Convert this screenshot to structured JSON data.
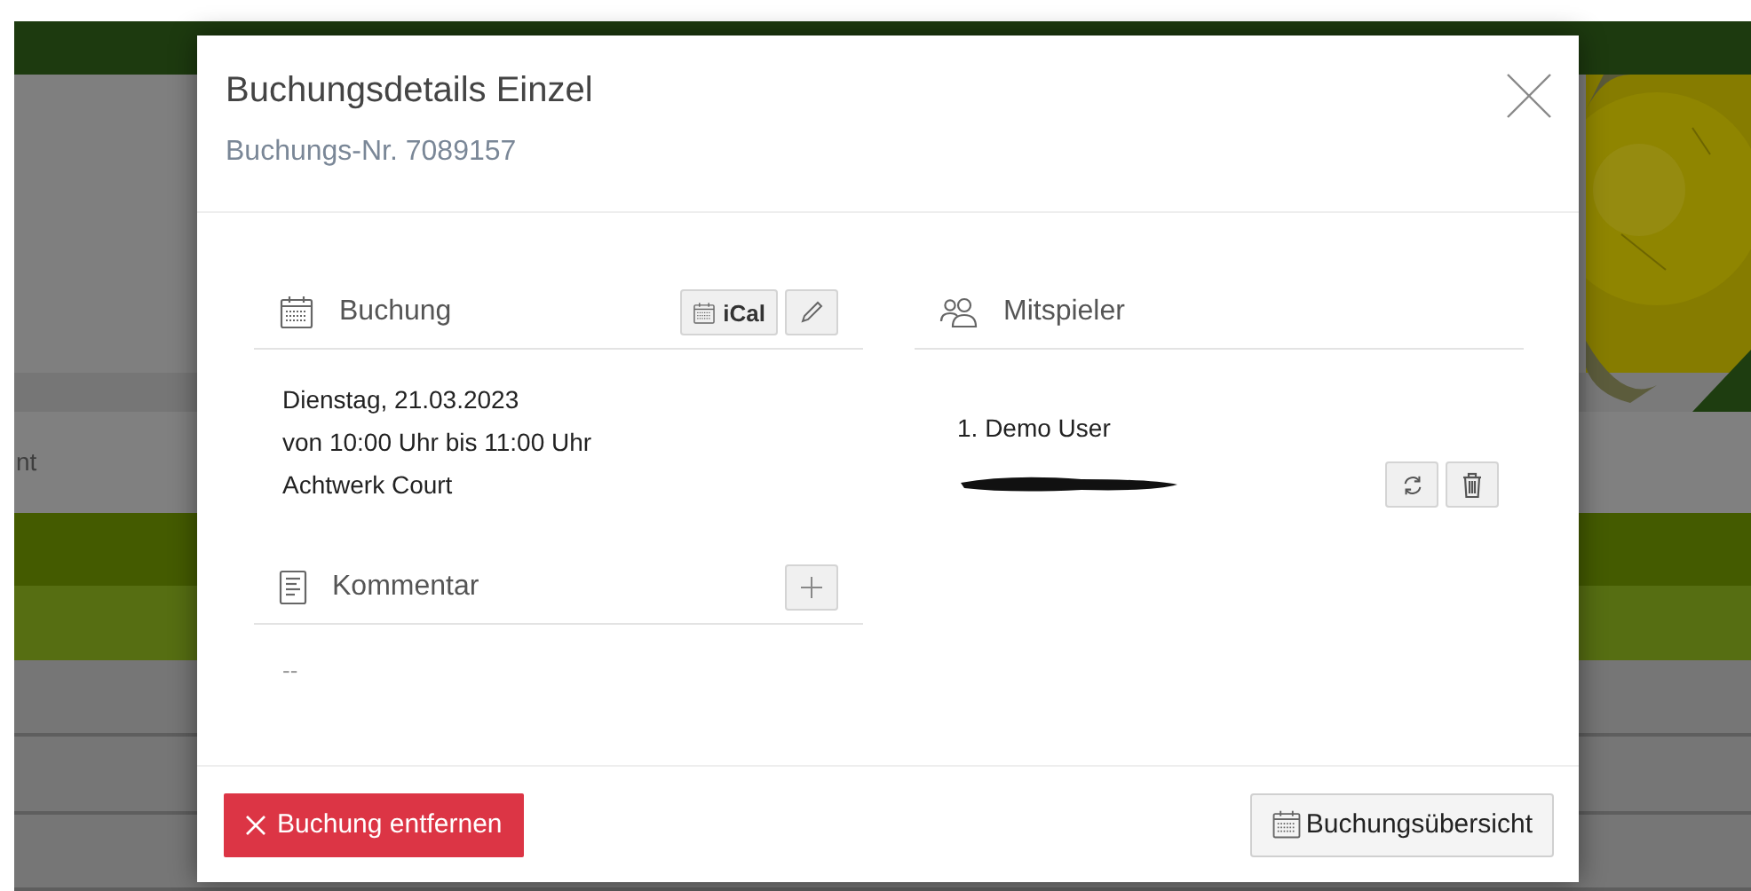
{
  "page": {
    "background_text": "nt"
  },
  "dialog": {
    "title": "Buchungsdetails Einzel",
    "subtitle": "Buchungs-Nr. 7089157",
    "booking": {
      "heading": "Buchung",
      "ical_button": "iCal",
      "lines": [
        "Dienstag, 21.03.2023",
        "von 10:00 Uhr bis 11:00 Uhr",
        "Achtwerk Court"
      ]
    },
    "comment": {
      "heading": "Kommentar",
      "text": "--"
    },
    "players": {
      "heading": "Mitspieler",
      "items": [
        {
          "name": "1. Demo User",
          "redacted": false,
          "actions": false
        },
        {
          "redacted": true,
          "actions": true
        }
      ]
    },
    "footer": {
      "remove_button": "Buchung entfernen",
      "overview_button": "Buchungsübersicht"
    }
  }
}
